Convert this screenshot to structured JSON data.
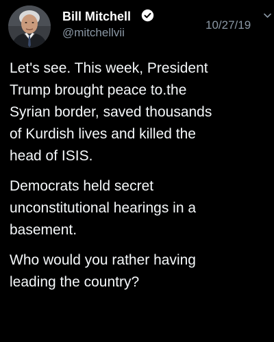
{
  "tweet": {
    "display_name": "Bill Mitchell",
    "handle": "@mitchellvii",
    "timestamp": "10/27/19",
    "verified_icon": "verified-badge-icon",
    "menu_icon": "chevron-down-icon",
    "paragraphs": [
      {
        "lines": [
          "Let's see. This week, President",
          "Trump brought peace to.the",
          "Syrian border, saved thousands",
          "of Kurdish lives and killed the",
          "head of ISIS."
        ]
      },
      {
        "lines": [
          "Democrats held secret",
          "unconstitutional hearings in a",
          "basement."
        ]
      },
      {
        "lines": [
          "Who would you rather having",
          "leading the country?"
        ]
      }
    ]
  },
  "colors": {
    "background": "#000000",
    "text": "#f5f8fa",
    "secondary_text": "#8b98a5",
    "verified_badge": "#ffffff"
  }
}
